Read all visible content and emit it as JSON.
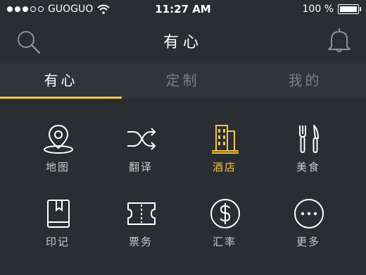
{
  "status_bar": {
    "signal_filled_dots": 3,
    "signal_total_dots": 5,
    "carrier": "GUOGUO",
    "time": "11:27 AM",
    "battery_text": "100 %",
    "battery_level": 1.0
  },
  "header": {
    "title": "有心",
    "left_icon": "search-icon",
    "right_icon": "bell-icon"
  },
  "tabs": [
    {
      "label": "有心",
      "active": true
    },
    {
      "label": "定制",
      "active": false
    },
    {
      "label": "我的",
      "active": false
    }
  ],
  "features": [
    {
      "label": "地图",
      "icon": "map-pin-icon",
      "active": false
    },
    {
      "label": "翻译",
      "icon": "shuffle-icon",
      "active": false
    },
    {
      "label": "酒店",
      "icon": "hotel-building-icon",
      "active": true
    },
    {
      "label": "美食",
      "icon": "fork-knife-icon",
      "active": false
    },
    {
      "label": "印记",
      "icon": "book-bookmark-icon",
      "active": false
    },
    {
      "label": "票务",
      "icon": "ticket-icon",
      "active": false
    },
    {
      "label": "汇率",
      "icon": "dollar-coin-icon",
      "active": false
    },
    {
      "label": "更多",
      "icon": "more-dots-icon",
      "active": false
    }
  ],
  "colors": {
    "background": "#2a2d31",
    "tab_bar": "#31343a",
    "accent": "#f5c646",
    "inactive_text": "#7b7e84"
  }
}
